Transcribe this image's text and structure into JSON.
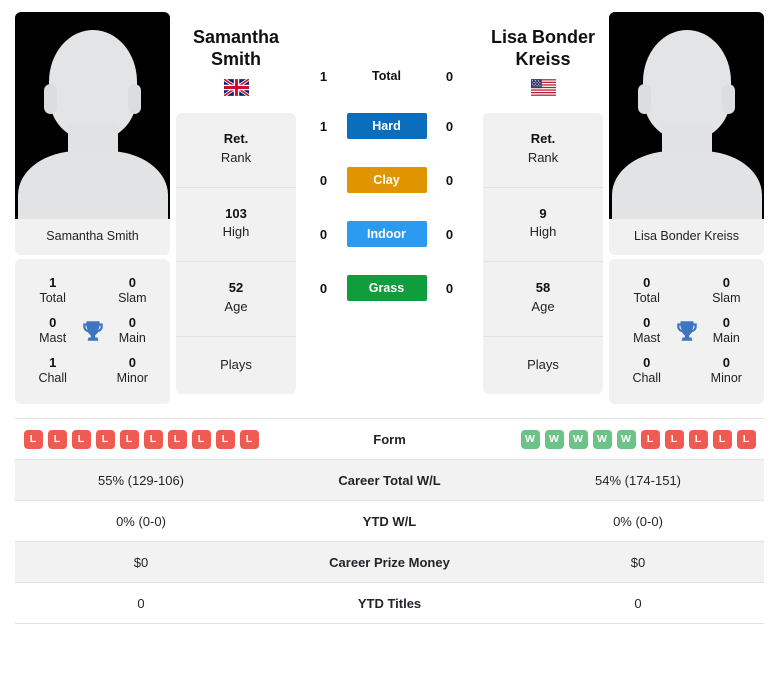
{
  "players": {
    "left": {
      "first_name": "Samantha",
      "last_name": "Smith",
      "full_name": "Samantha Smith",
      "photo_caption": "Samantha Smith",
      "flag": "gb-flag-icon",
      "country": "GB",
      "titles": {
        "total_value": "1",
        "total_label": "Total",
        "slam_value": "0",
        "slam_label": "Slam",
        "mast_value": "0",
        "mast_label": "Mast",
        "main_value": "0",
        "main_label": "Main",
        "chall_value": "1",
        "chall_label": "Chall",
        "minor_value": "0",
        "minor_label": "Minor"
      },
      "info": [
        {
          "value": "Ret.",
          "label": "Rank"
        },
        {
          "value": "103",
          "label": "High"
        },
        {
          "value": "52",
          "label": "Age"
        },
        {
          "value": "",
          "label": "Plays"
        }
      ],
      "form": [
        "L",
        "L",
        "L",
        "L",
        "L",
        "L",
        "L",
        "L",
        "L",
        "L"
      ],
      "career_total_wl": "55% (129-106)",
      "ytd_wl": "0% (0-0)",
      "career_prize_money": "$0",
      "ytd_titles": "0"
    },
    "right": {
      "first_name": "Lisa Bonder",
      "last_name": "Kreiss",
      "full_name": "Lisa Bonder Kreiss",
      "photo_caption": "Lisa Bonder Kreiss",
      "flag": "us-flag-icon",
      "country": "US",
      "titles": {
        "total_value": "0",
        "total_label": "Total",
        "slam_value": "0",
        "slam_label": "Slam",
        "mast_value": "0",
        "mast_label": "Mast",
        "main_value": "0",
        "main_label": "Main",
        "chall_value": "0",
        "chall_label": "Chall",
        "minor_value": "0",
        "minor_label": "Minor"
      },
      "info": [
        {
          "value": "Ret.",
          "label": "Rank"
        },
        {
          "value": "9",
          "label": "High"
        },
        {
          "value": "58",
          "label": "Age"
        },
        {
          "value": "",
          "label": "Plays"
        }
      ],
      "form": [
        "W",
        "W",
        "W",
        "W",
        "W",
        "L",
        "L",
        "L",
        "L",
        "L"
      ],
      "career_total_wl": "54% (174-151)",
      "ytd_wl": "0% (0-0)",
      "career_prize_money": "$0",
      "ytd_titles": "0"
    }
  },
  "surfaces": [
    {
      "label": "Total",
      "left": "1",
      "right": "0",
      "color": "transparent",
      "chip": false
    },
    {
      "label": "Hard",
      "left": "1",
      "right": "0",
      "color": "#0a6ebd",
      "chip": true
    },
    {
      "label": "Clay",
      "left": "0",
      "right": "0",
      "color": "#e09400",
      "chip": true
    },
    {
      "label": "Indoor",
      "left": "0",
      "right": "0",
      "color": "#2b9bf2",
      "chip": true
    },
    {
      "label": "Grass",
      "left": "0",
      "right": "0",
      "color": "#0f9d3d",
      "chip": true
    }
  ],
  "table_rows": [
    {
      "label": "Form",
      "type": "badges",
      "left": "",
      "right": ""
    },
    {
      "label": "Career Total W/L",
      "type": "text",
      "left": "55% (129-106)",
      "right": "54% (174-151)"
    },
    {
      "label": "YTD W/L",
      "type": "text",
      "left": "0% (0-0)",
      "right": "0% (0-0)"
    },
    {
      "label": "Career Prize Money",
      "type": "text",
      "left": "$0",
      "right": "$0"
    },
    {
      "label": "YTD Titles",
      "type": "text",
      "left": "0",
      "right": "0"
    }
  ],
  "colors": {
    "win_badge": "#6cc387",
    "loss_badge": "#ef5b50",
    "card_bg": "#f1f1f1",
    "row_alt_bg": "#f2f2f2",
    "trophy": "#3f74c0"
  },
  "icons": {
    "trophy": "trophy-icon"
  }
}
